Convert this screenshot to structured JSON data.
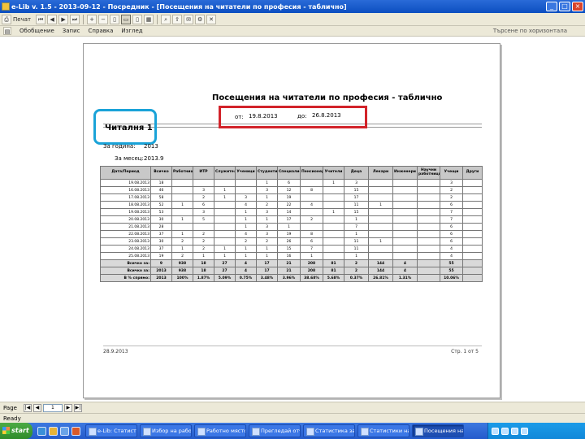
{
  "window": {
    "title": "e-Lib v. 1.5 - 2013-09-12 - Посредник - [Посещения на читатели по професия - таблично]",
    "min": "_",
    "max": "□",
    "close": "×"
  },
  "toolbar": {
    "print_label": "Печат"
  },
  "menu": {
    "items": [
      "Обобщение",
      "Запис",
      "Справка",
      "Изглед"
    ],
    "right_text": "Търсене по хоризонтала"
  },
  "report": {
    "title": "Посещения на читатели по професия - таблично",
    "from_label": "от:",
    "from_date": "19.8.2013",
    "to_label": "до:",
    "to_date": "26.8.2013",
    "hall": "Читалня 1",
    "year_label": "За година:",
    "year": "2013",
    "month_label": "За месец:",
    "month": "2013.9",
    "headers": [
      "Дата/Период",
      "Всичко",
      "Работници",
      "ИТР",
      "Служители",
      "Ученици",
      "Студенти",
      "Специалисти",
      "Пенсионери",
      "Учители",
      "Деца",
      "Лекари",
      "Инженери",
      "Научни работници",
      "Учещи",
      "Други"
    ],
    "rows": [
      [
        "19.08.2013",
        "18",
        "",
        "",
        "",
        "",
        "1",
        "6",
        "",
        "1",
        "3",
        "",
        "",
        "",
        "3",
        ""
      ],
      [
        "16.08.2013",
        "46",
        "",
        "3",
        "1",
        "",
        "3",
        "12",
        "8",
        "",
        "15",
        "",
        "",
        "",
        "2",
        ""
      ],
      [
        "17.08.2013",
        "58",
        "",
        "2",
        "1",
        "3",
        "1",
        "19",
        "",
        "",
        "17",
        "",
        "",
        "",
        "2",
        ""
      ],
      [
        "18.08.2013",
        "52",
        "1",
        "6",
        "",
        "4",
        "2",
        "22",
        "4",
        "",
        "11",
        "1",
        "",
        "",
        "6",
        ""
      ],
      [
        "19.08.2013",
        "53",
        "",
        "3",
        "",
        "1",
        "3",
        "14",
        "",
        "1",
        "15",
        "",
        "",
        "",
        "7",
        ""
      ],
      [
        "20.08.2013",
        "30",
        "1",
        "5",
        "",
        "1",
        "1",
        "17",
        "2",
        "",
        "1",
        "",
        "",
        "",
        "7",
        ""
      ],
      [
        "21.08.2013",
        "28",
        "",
        "",
        "",
        "1",
        "3",
        "1",
        "",
        "",
        "7",
        "",
        "",
        "",
        "6",
        ""
      ],
      [
        "22.08.2013",
        "37",
        "1",
        "2",
        "",
        "4",
        "3",
        "19",
        "8",
        "",
        "1",
        "",
        "",
        "",
        "6",
        ""
      ],
      [
        "23.08.2013",
        "30",
        "2",
        "2",
        "",
        "2",
        "2",
        "26",
        "6",
        "",
        "11",
        "1",
        "",
        "",
        "6",
        ""
      ],
      [
        "24.08.2013",
        "37",
        "1",
        "2",
        "1",
        "1",
        "1",
        "15",
        "7",
        "",
        "11",
        "",
        "",
        "",
        "4",
        ""
      ],
      [
        "25.08.2013",
        "19",
        "2",
        "1",
        "1",
        "1",
        "1",
        "16",
        "1",
        "",
        "1",
        "",
        "",
        "",
        "4",
        ""
      ]
    ],
    "totals": [
      [
        "Всичко за:",
        "9",
        "938",
        "18",
        "27",
        "4",
        "17",
        "21",
        "208",
        "81",
        "2",
        "144",
        "4",
        "",
        "55"
      ],
      [
        "Всичко за:",
        "2013",
        "938",
        "18",
        "27",
        "4",
        "17",
        "21",
        "208",
        "81",
        "2",
        "144",
        "4",
        "",
        "55"
      ],
      [
        "В % спрямо:",
        "2013",
        "100%",
        "1.87%",
        "5.09%",
        "0.75%",
        "3.48%",
        "3.96%",
        "38.68%",
        "5.68%",
        "0.37%",
        "26.81%",
        "1.31%",
        "",
        "10.06%"
      ]
    ],
    "footer_left": "28.9.2013",
    "footer_right": "Стр. 1 от 5"
  },
  "pagebar": {
    "label": "Page",
    "current_page": "1"
  },
  "status": {
    "text": "Ready"
  },
  "taskbar": {
    "start": "start",
    "tasks": [
      "e-Lib: Статистика ...",
      "Избор на работ...",
      "Работно място",
      "Прегледай отчет...",
      "Статистика за ...",
      "Статистики на ...",
      "Посещения на ..."
    ]
  }
}
